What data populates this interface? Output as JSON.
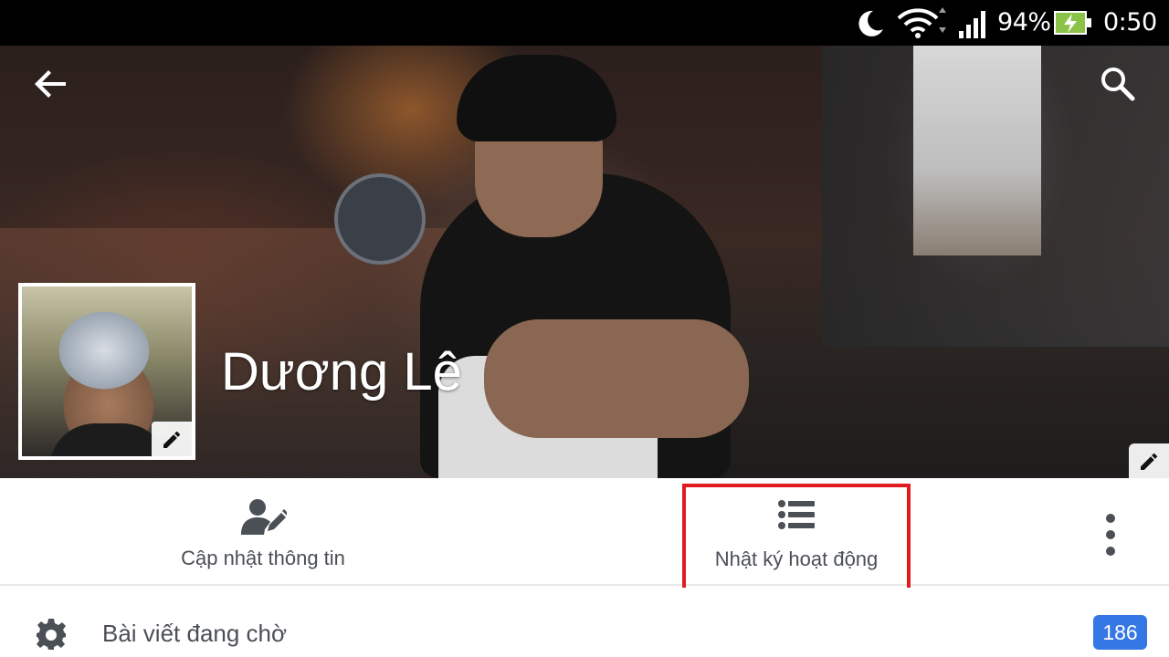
{
  "status_bar": {
    "battery_percent": "94%",
    "time": "0:50",
    "icons": [
      "moon-icon",
      "wifi-icon",
      "signal-icon",
      "battery-charging-icon"
    ]
  },
  "header": {
    "back_icon": "arrow-left-icon",
    "search_icon": "search-icon"
  },
  "profile": {
    "name": "Dương Lê",
    "profile_edit_icon": "pencil-icon",
    "cover_edit_icon": "pencil-icon"
  },
  "actions": {
    "update_info": {
      "label": "Cập nhật thông tin",
      "icon": "person-edit-icon"
    },
    "activity_log": {
      "label": "Nhật ký hoạt động",
      "icon": "list-icon",
      "highlight_color": "#e21b23"
    },
    "more_icon": "more-vertical-icon"
  },
  "pending_posts": {
    "label": "Bài viết đang chờ",
    "count": "186",
    "icon": "gear-icon",
    "badge_color": "#3578e5"
  }
}
